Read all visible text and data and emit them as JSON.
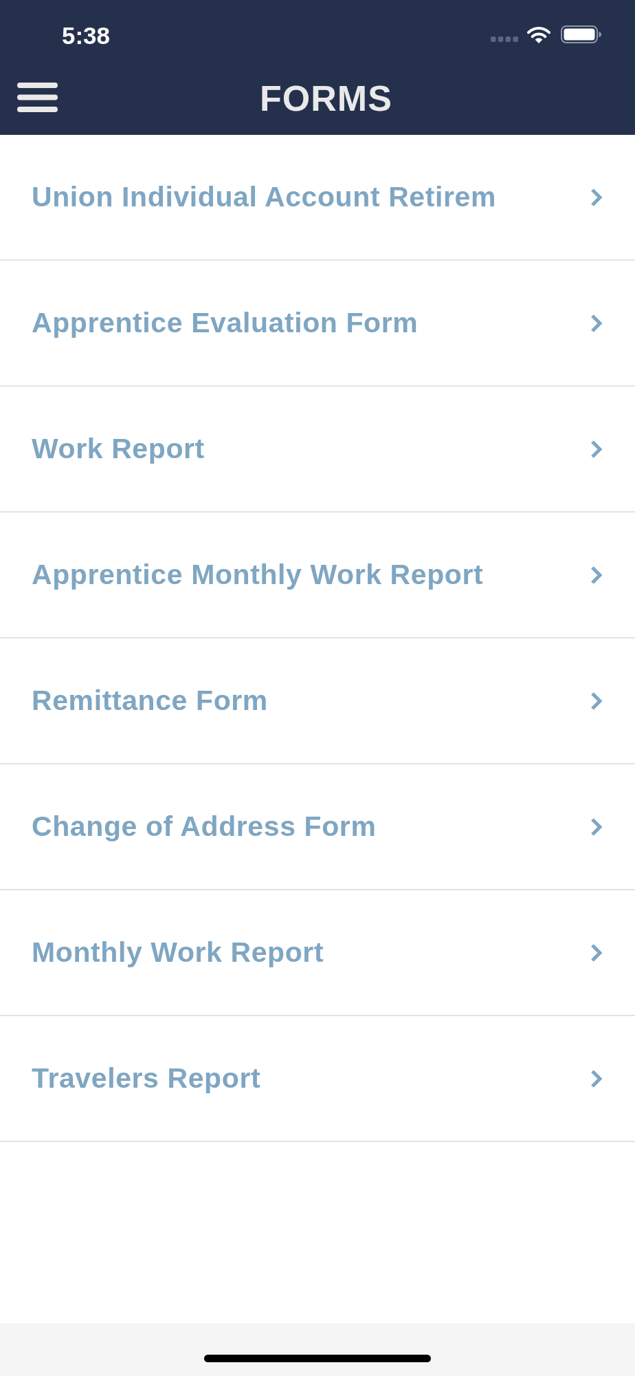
{
  "status_bar": {
    "time": "5:38"
  },
  "header": {
    "title": "FORMS"
  },
  "forms": [
    {
      "label": "Union Individual Account Retirem"
    },
    {
      "label": "Apprentice Evaluation Form"
    },
    {
      "label": "Work Report"
    },
    {
      "label": "Apprentice Monthly Work Report"
    },
    {
      "label": "Remittance Form"
    },
    {
      "label": "Change of Address Form"
    },
    {
      "label": "Monthly Work Report"
    },
    {
      "label": "Travelers Report"
    }
  ]
}
